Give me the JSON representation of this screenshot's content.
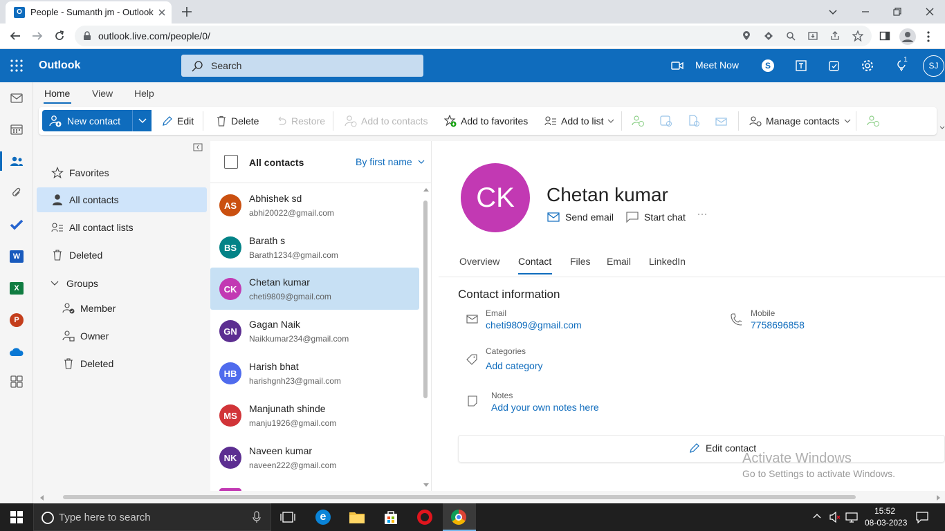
{
  "browser": {
    "tab_title": "People - Sumanth jm - Outlook",
    "url": "outlook.live.com/people/0/"
  },
  "header": {
    "app_name": "Outlook",
    "search_placeholder": "Search",
    "meet_now": "Meet Now",
    "notification_count": "1",
    "user_initials": "SJ"
  },
  "ribbon": {
    "tabs": [
      "Home",
      "View",
      "Help"
    ],
    "active_tab": "Home",
    "new_contact": "New contact",
    "edit": "Edit",
    "delete": "Delete",
    "restore": "Restore",
    "add_to_contacts": "Add to contacts",
    "add_to_favorites": "Add to favorites",
    "add_to_list": "Add to list",
    "manage_contacts": "Manage contacts"
  },
  "nav": {
    "favorites": "Favorites",
    "all_contacts": "All contacts",
    "all_contact_lists": "All contact lists",
    "deleted": "Deleted",
    "groups": "Groups",
    "member": "Member",
    "owner": "Owner",
    "groups_deleted": "Deleted"
  },
  "list": {
    "header": "All contacts",
    "sort": "By first name",
    "contacts": [
      {
        "initials": "AS",
        "name": "Abhishek sd",
        "email": "abhi20022@gmail.com",
        "color": "#ca5010"
      },
      {
        "initials": "BS",
        "name": "Barath s",
        "email": "Barath1234@gmail.com",
        "color": "#038387"
      },
      {
        "initials": "CK",
        "name": "Chetan kumar",
        "email": "cheti9809@gmail.com",
        "color": "#c239b3"
      },
      {
        "initials": "GN",
        "name": "Gagan Naik",
        "email": "Naikkumar234@gmail.com",
        "color": "#5c2e91"
      },
      {
        "initials": "HB",
        "name": "Harish bhat",
        "email": "harishgnh23@gmail.com",
        "color": "#4f6bed"
      },
      {
        "initials": "MS",
        "name": "Manjunath shinde",
        "email": "manju1926@gmail.com",
        "color": "#d13438"
      },
      {
        "initials": "NK",
        "name": "Naveen kumar",
        "email": "naveen222@gmail.com",
        "color": "#5c2e91"
      }
    ]
  },
  "detail": {
    "initials": "CK",
    "name": "Chetan kumar",
    "send_email": "Send email",
    "start_chat": "Start chat",
    "tabs": [
      "Overview",
      "Contact",
      "Files",
      "Email",
      "LinkedIn"
    ],
    "active_tab": "Contact",
    "section_title": "Contact information",
    "email_label": "Email",
    "email_value": "cheti9809@gmail.com",
    "mobile_label": "Mobile",
    "mobile_value": "7758696858",
    "categories_label": "Categories",
    "add_category": "Add category",
    "notes_label": "Notes",
    "add_notes": "Add your own notes here",
    "edit_contact": "Edit contact"
  },
  "watermark": {
    "title": "Activate Windows",
    "subtitle": "Go to Settings to activate Windows."
  },
  "taskbar": {
    "search_placeholder": "Type here to search",
    "time": "15:52",
    "date": "08-03-2023"
  }
}
